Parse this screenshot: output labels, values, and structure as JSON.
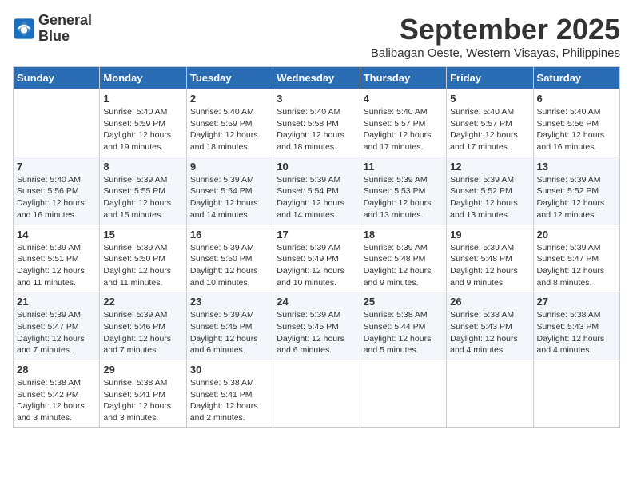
{
  "logo": {
    "line1": "General",
    "line2": "Blue"
  },
  "title": "September 2025",
  "location": "Balibagan Oeste, Western Visayas, Philippines",
  "days_of_week": [
    "Sunday",
    "Monday",
    "Tuesday",
    "Wednesday",
    "Thursday",
    "Friday",
    "Saturday"
  ],
  "weeks": [
    [
      {
        "day": "",
        "text": ""
      },
      {
        "day": "1",
        "text": "Sunrise: 5:40 AM\nSunset: 5:59 PM\nDaylight: 12 hours\nand 19 minutes."
      },
      {
        "day": "2",
        "text": "Sunrise: 5:40 AM\nSunset: 5:59 PM\nDaylight: 12 hours\nand 18 minutes."
      },
      {
        "day": "3",
        "text": "Sunrise: 5:40 AM\nSunset: 5:58 PM\nDaylight: 12 hours\nand 18 minutes."
      },
      {
        "day": "4",
        "text": "Sunrise: 5:40 AM\nSunset: 5:57 PM\nDaylight: 12 hours\nand 17 minutes."
      },
      {
        "day": "5",
        "text": "Sunrise: 5:40 AM\nSunset: 5:57 PM\nDaylight: 12 hours\nand 17 minutes."
      },
      {
        "day": "6",
        "text": "Sunrise: 5:40 AM\nSunset: 5:56 PM\nDaylight: 12 hours\nand 16 minutes."
      }
    ],
    [
      {
        "day": "7",
        "text": "Sunrise: 5:40 AM\nSunset: 5:56 PM\nDaylight: 12 hours\nand 16 minutes."
      },
      {
        "day": "8",
        "text": "Sunrise: 5:39 AM\nSunset: 5:55 PM\nDaylight: 12 hours\nand 15 minutes."
      },
      {
        "day": "9",
        "text": "Sunrise: 5:39 AM\nSunset: 5:54 PM\nDaylight: 12 hours\nand 14 minutes."
      },
      {
        "day": "10",
        "text": "Sunrise: 5:39 AM\nSunset: 5:54 PM\nDaylight: 12 hours\nand 14 minutes."
      },
      {
        "day": "11",
        "text": "Sunrise: 5:39 AM\nSunset: 5:53 PM\nDaylight: 12 hours\nand 13 minutes."
      },
      {
        "day": "12",
        "text": "Sunrise: 5:39 AM\nSunset: 5:52 PM\nDaylight: 12 hours\nand 13 minutes."
      },
      {
        "day": "13",
        "text": "Sunrise: 5:39 AM\nSunset: 5:52 PM\nDaylight: 12 hours\nand 12 minutes."
      }
    ],
    [
      {
        "day": "14",
        "text": "Sunrise: 5:39 AM\nSunset: 5:51 PM\nDaylight: 12 hours\nand 11 minutes."
      },
      {
        "day": "15",
        "text": "Sunrise: 5:39 AM\nSunset: 5:50 PM\nDaylight: 12 hours\nand 11 minutes."
      },
      {
        "day": "16",
        "text": "Sunrise: 5:39 AM\nSunset: 5:50 PM\nDaylight: 12 hours\nand 10 minutes."
      },
      {
        "day": "17",
        "text": "Sunrise: 5:39 AM\nSunset: 5:49 PM\nDaylight: 12 hours\nand 10 minutes."
      },
      {
        "day": "18",
        "text": "Sunrise: 5:39 AM\nSunset: 5:48 PM\nDaylight: 12 hours\nand 9 minutes."
      },
      {
        "day": "19",
        "text": "Sunrise: 5:39 AM\nSunset: 5:48 PM\nDaylight: 12 hours\nand 9 minutes."
      },
      {
        "day": "20",
        "text": "Sunrise: 5:39 AM\nSunset: 5:47 PM\nDaylight: 12 hours\nand 8 minutes."
      }
    ],
    [
      {
        "day": "21",
        "text": "Sunrise: 5:39 AM\nSunset: 5:47 PM\nDaylight: 12 hours\nand 7 minutes."
      },
      {
        "day": "22",
        "text": "Sunrise: 5:39 AM\nSunset: 5:46 PM\nDaylight: 12 hours\nand 7 minutes."
      },
      {
        "day": "23",
        "text": "Sunrise: 5:39 AM\nSunset: 5:45 PM\nDaylight: 12 hours\nand 6 minutes."
      },
      {
        "day": "24",
        "text": "Sunrise: 5:39 AM\nSunset: 5:45 PM\nDaylight: 12 hours\nand 6 minutes."
      },
      {
        "day": "25",
        "text": "Sunrise: 5:38 AM\nSunset: 5:44 PM\nDaylight: 12 hours\nand 5 minutes."
      },
      {
        "day": "26",
        "text": "Sunrise: 5:38 AM\nSunset: 5:43 PM\nDaylight: 12 hours\nand 4 minutes."
      },
      {
        "day": "27",
        "text": "Sunrise: 5:38 AM\nSunset: 5:43 PM\nDaylight: 12 hours\nand 4 minutes."
      }
    ],
    [
      {
        "day": "28",
        "text": "Sunrise: 5:38 AM\nSunset: 5:42 PM\nDaylight: 12 hours\nand 3 minutes."
      },
      {
        "day": "29",
        "text": "Sunrise: 5:38 AM\nSunset: 5:41 PM\nDaylight: 12 hours\nand 3 minutes."
      },
      {
        "day": "30",
        "text": "Sunrise: 5:38 AM\nSunset: 5:41 PM\nDaylight: 12 hours\nand 2 minutes."
      },
      {
        "day": "",
        "text": ""
      },
      {
        "day": "",
        "text": ""
      },
      {
        "day": "",
        "text": ""
      },
      {
        "day": "",
        "text": ""
      }
    ]
  ]
}
